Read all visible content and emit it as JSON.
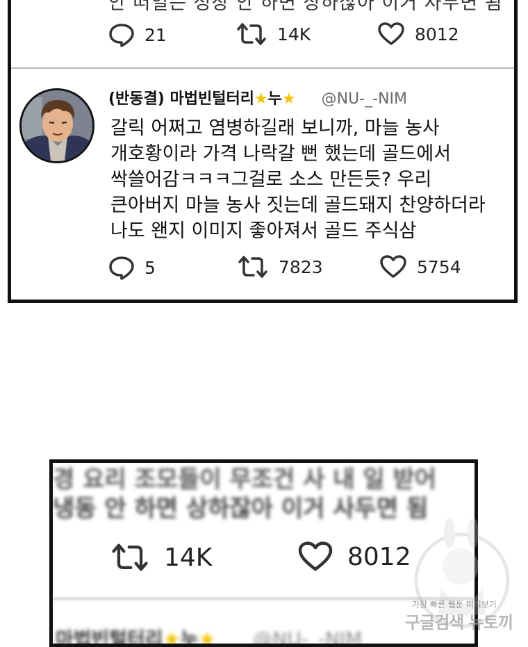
{
  "top_panel": {
    "prev_tweet_cut_text": "안 떠얼는 성장 안 하면 상하잖아 이거 사두면 됨",
    "prev_stats": {
      "replies": "21",
      "retweets": "14K",
      "likes": "8012"
    },
    "tweet": {
      "display_name_prefix": "(반동결) 마법빈털터리",
      "star1": "★",
      "name_mid": "누",
      "star2": "★",
      "handle": "@NU-_-NIM",
      "lines": [
        "갈릭 어쩌고 염병하길래 보니까, 마늘 농사",
        "개호황이라 가격 나락갈 뻔 했는데 골드에서",
        "싹쓸어감ㅋㅋㅋ그걸로 소스 만든듯? 우리",
        "큰아버지 마늘 농사 짓는데 골드돼지 찬양하더라",
        "나도 왠지 이미지 좋아져서 골드 주식삼"
      ],
      "stats": {
        "replies": "5",
        "retweets": "7823",
        "likes": "5754"
      }
    }
  },
  "bottom_panel": {
    "blurred_line1": "경 요리 조모들이 무조건 사 내 일 받어",
    "blurred_line2": "냉동 안 하면 상하잖아 이거 사두면 됨",
    "stats": {
      "retweets": "14K",
      "likes": "8012"
    },
    "blurred_name_prefix": "마법빈털터리",
    "blurred_star1": "★",
    "blurred_name_mid": "누",
    "blurred_star2": "★",
    "blurred_handle": "@NU-_-NIM"
  },
  "watermark": {
    "line1": "가장 빠른 웹툰 미리보기",
    "line2": "구글검색 뉴토끼"
  },
  "colors": {
    "star": "#f2c200",
    "handle": "#6a6a6a",
    "border": "#111111"
  }
}
